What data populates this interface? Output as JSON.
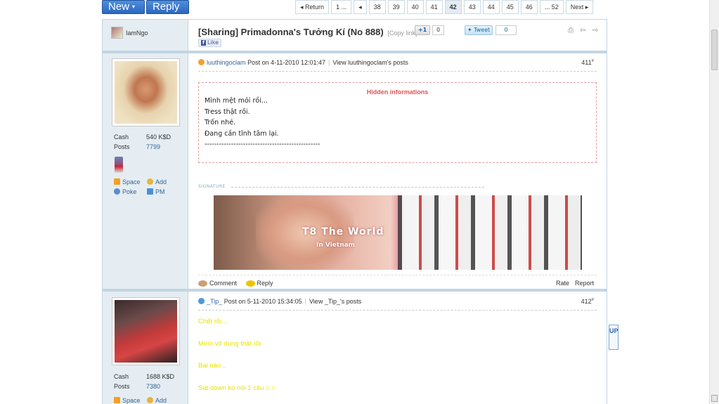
{
  "toolbar": {
    "new_label": "New",
    "new_caret": "▾",
    "reply_label": "Reply"
  },
  "pager": [
    "Return",
    "1 ...",
    "◂",
    "38",
    "39",
    "40",
    "41",
    "42",
    "43",
    "44",
    "45",
    "46",
    "... 52",
    "Next ▸"
  ],
  "pager_active": "42",
  "thread": {
    "starter": "IamNgo",
    "title": "[Sharing] Primadonna's Tưởng Kí (No 888)",
    "copy_link": "[Copy link]",
    "gplus_label": "+1",
    "gplus_count": "0",
    "tweet_label": "Tweet",
    "tweet_count": "0",
    "fb_like": "Like",
    "tools": "⎙ ⇦ ⇨"
  },
  "post1": {
    "author": "luuthingoclam",
    "posted": "Post on 4-11-2010 12:01:47",
    "view_posts": "View luuthingoclam's posts",
    "floor": "411",
    "floor_sup": "#",
    "stats": {
      "cash_label": "Cash",
      "cash": "540 K$D",
      "posts_label": "Posts",
      "posts": "7799"
    },
    "links": {
      "space": "Space",
      "add": "Add",
      "poke": "Poke",
      "pm": "PM"
    },
    "hidden_title": "Hidden informations",
    "hidden_lines": [
      "Mình mệt mỏi rồi...",
      "Tress thật rồi.",
      "Trốn nhé.",
      "Đang cần tĩnh tâm lại.",
      "------------------------------------------------"
    ],
    "signature_label": "SIGNATURE",
    "banner_text1": "T8 The World",
    "banner_text2": "In Vietnam",
    "comment": "Comment",
    "reply": "Reply",
    "rate": "Rate",
    "report": "Report"
  },
  "post2": {
    "author": "_Tip_",
    "posted": "Post on 5-11-2010 15:34:05",
    "view_posts": "View _Tip_'s posts",
    "floor": "412",
    "floor_sup": "#",
    "stats": {
      "cash_label": "Cash",
      "cash": "1688 K$D",
      "posts_label": "Posts",
      "posts": "7380"
    },
    "links": {
      "space": "Space",
      "add": "Add"
    },
    "lines": [
      "Chết rồi...",
      "Mình vô dụng thật rồi",
      "Bai nào...",
      "Sat down ko nói 1 câu =.="
    ]
  },
  "up_button": "UP",
  "colors": {
    "accent": "#2b67c0",
    "frame": "#c2d5e3",
    "sidebar": "#e5edf2",
    "hidden": "#e0555a",
    "yellow_text": "#e8e300"
  }
}
